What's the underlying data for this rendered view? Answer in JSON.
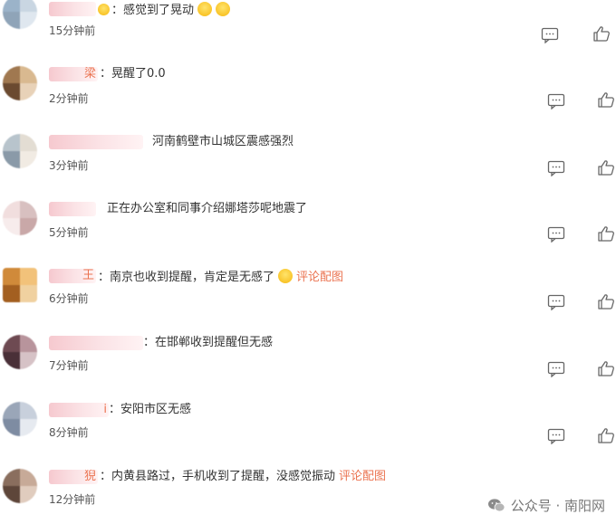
{
  "comments": [
    {
      "name_suffix": "",
      "text": "感觉到了晃动",
      "time": "15分钟前",
      "colors": [
        "#9bb3c9",
        "#c9d6e2",
        "#8fa4b8",
        "#dfe7ef"
      ]
    },
    {
      "name_suffix": "梁",
      "text": "晃醒了0.0",
      "time": "2分钟前",
      "colors": [
        "#a07850",
        "#d9b990",
        "#6b4a30",
        "#e8d2b8"
      ]
    },
    {
      "name_suffix": "",
      "text": "河南鹤壁市山城区震感强烈",
      "time": "3分钟前",
      "colors": [
        "#b8c4cc",
        "#e3ddd3",
        "#8a9aa8",
        "#f1ebe3"
      ]
    },
    {
      "name_suffix": "",
      "text": "正在办公室和同事介绍娜塔莎呢地震了",
      "time": "5分钟前",
      "colors": [
        "#f1dede",
        "#d8c0c0",
        "#f7ecec",
        "#c9a8a8"
      ]
    },
    {
      "name_suffix": "王",
      "text": "南京也收到提醒，肯定是无感了",
      "pic": "评论配图",
      "time": "6分钟前",
      "colors": [
        "#d08a3a",
        "#f2c27a",
        "#a35f20",
        "#f0d1a0"
      ]
    },
    {
      "name_suffix": "",
      "text": "在邯郸收到提醒但无感",
      "time": "7分钟前",
      "colors": [
        "#6e4a52",
        "#b8949c",
        "#4a3038",
        "#d6c2c6"
      ]
    },
    {
      "name_suffix": "i",
      "text": "安阳市区无感",
      "time": "8分钟前",
      "colors": [
        "#9aa6b8",
        "#c8d0dc",
        "#7e8ca2",
        "#e6eaf0"
      ]
    },
    {
      "name_suffix": "猊",
      "text": "内黄县路过，手机收到了提醒，没感觉振动",
      "pic": "评论配图",
      "time": "12分钟前",
      "colors": [
        "#8a6e5e",
        "#c7aa98",
        "#5e463a",
        "#e0ccbe"
      ]
    }
  ],
  "watermark": "公众号 · 南阳网",
  "icons": {
    "comment": "comment-icon",
    "like": "thumbs-up-icon"
  }
}
